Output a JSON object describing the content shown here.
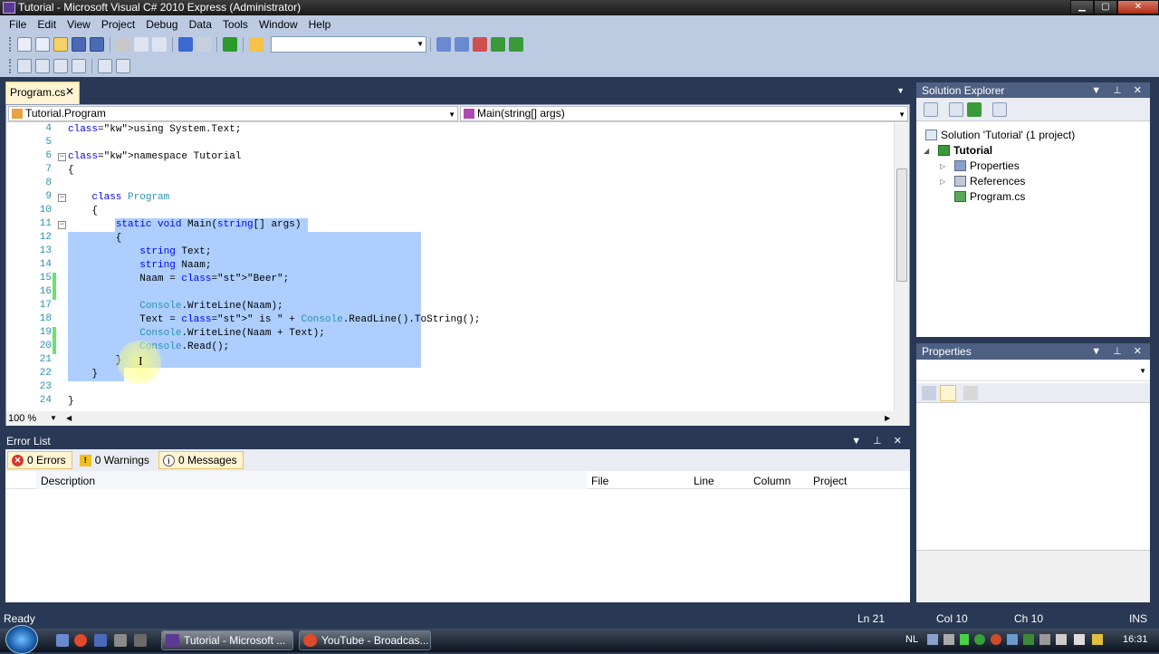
{
  "window": {
    "title": "Tutorial - Microsoft Visual C# 2010 Express (Administrator)",
    "btn_min": "▁",
    "btn_max": "▢",
    "btn_close": "✕"
  },
  "menu": [
    "File",
    "Edit",
    "View",
    "Project",
    "Debug",
    "Data",
    "Tools",
    "Window",
    "Help"
  ],
  "doc_tab": {
    "label": "Program.cs",
    "close": "✕"
  },
  "nav": {
    "left": "Tutorial.Program",
    "right": "Main(string[] args)"
  },
  "editor": {
    "lines": [
      {
        "n": "4",
        "text": "using System.Text;"
      },
      {
        "n": "5",
        "text": ""
      },
      {
        "n": "6",
        "text": "namespace Tutorial"
      },
      {
        "n": "7",
        "text": "{"
      },
      {
        "n": "8",
        "text": ""
      },
      {
        "n": "9",
        "text": "    class Program"
      },
      {
        "n": "10",
        "text": "    {"
      },
      {
        "n": "11",
        "text": "        static void Main(string[] args)"
      },
      {
        "n": "12",
        "text": "        {"
      },
      {
        "n": "13",
        "text": "            string Text;"
      },
      {
        "n": "14",
        "text": "            string Naam;"
      },
      {
        "n": "15",
        "text": "            Naam = \"Beer\";"
      },
      {
        "n": "16",
        "text": ""
      },
      {
        "n": "17",
        "text": "            Console.WriteLine(Naam);"
      },
      {
        "n": "18",
        "text": "            Text = \" is \" + Console.ReadLine().ToString();"
      },
      {
        "n": "19",
        "text": "            Console.WriteLine(Naam + Text);"
      },
      {
        "n": "20",
        "text": "            Console.Read();"
      },
      {
        "n": "21",
        "text": "        }"
      },
      {
        "n": "22",
        "text": "    }"
      },
      {
        "n": "23",
        "text": ""
      },
      {
        "n": "24",
        "text": "}"
      }
    ],
    "zoom": "100 %"
  },
  "solution_explorer": {
    "title": "Solution Explorer",
    "solution": "Solution 'Tutorial' (1 project)",
    "project": "Tutorial",
    "items": [
      "Properties",
      "References",
      "Program.cs"
    ]
  },
  "properties": {
    "title": "Properties"
  },
  "error_list": {
    "title": "Error List",
    "errors": "0 Errors",
    "warnings": "0 Warnings",
    "messages": "0 Messages",
    "columns": [
      "Description",
      "File",
      "Line",
      "Column",
      "Project"
    ]
  },
  "status": {
    "ready": "Ready",
    "ln": "Ln 21",
    "col": "Col 10",
    "ch": "Ch 10",
    "ins": "INS"
  },
  "taskbar": {
    "btn1": "Tutorial - Microsoft ...",
    "btn2": "YouTube - Broadcas...",
    "lang": "NL",
    "time": "16:31"
  },
  "colors": {
    "chrome": "#293955",
    "toolbar": "#bccbe2",
    "selection": "#adceff",
    "keyword": "#0000ff",
    "type": "#2b91af",
    "string": "#a31515"
  }
}
